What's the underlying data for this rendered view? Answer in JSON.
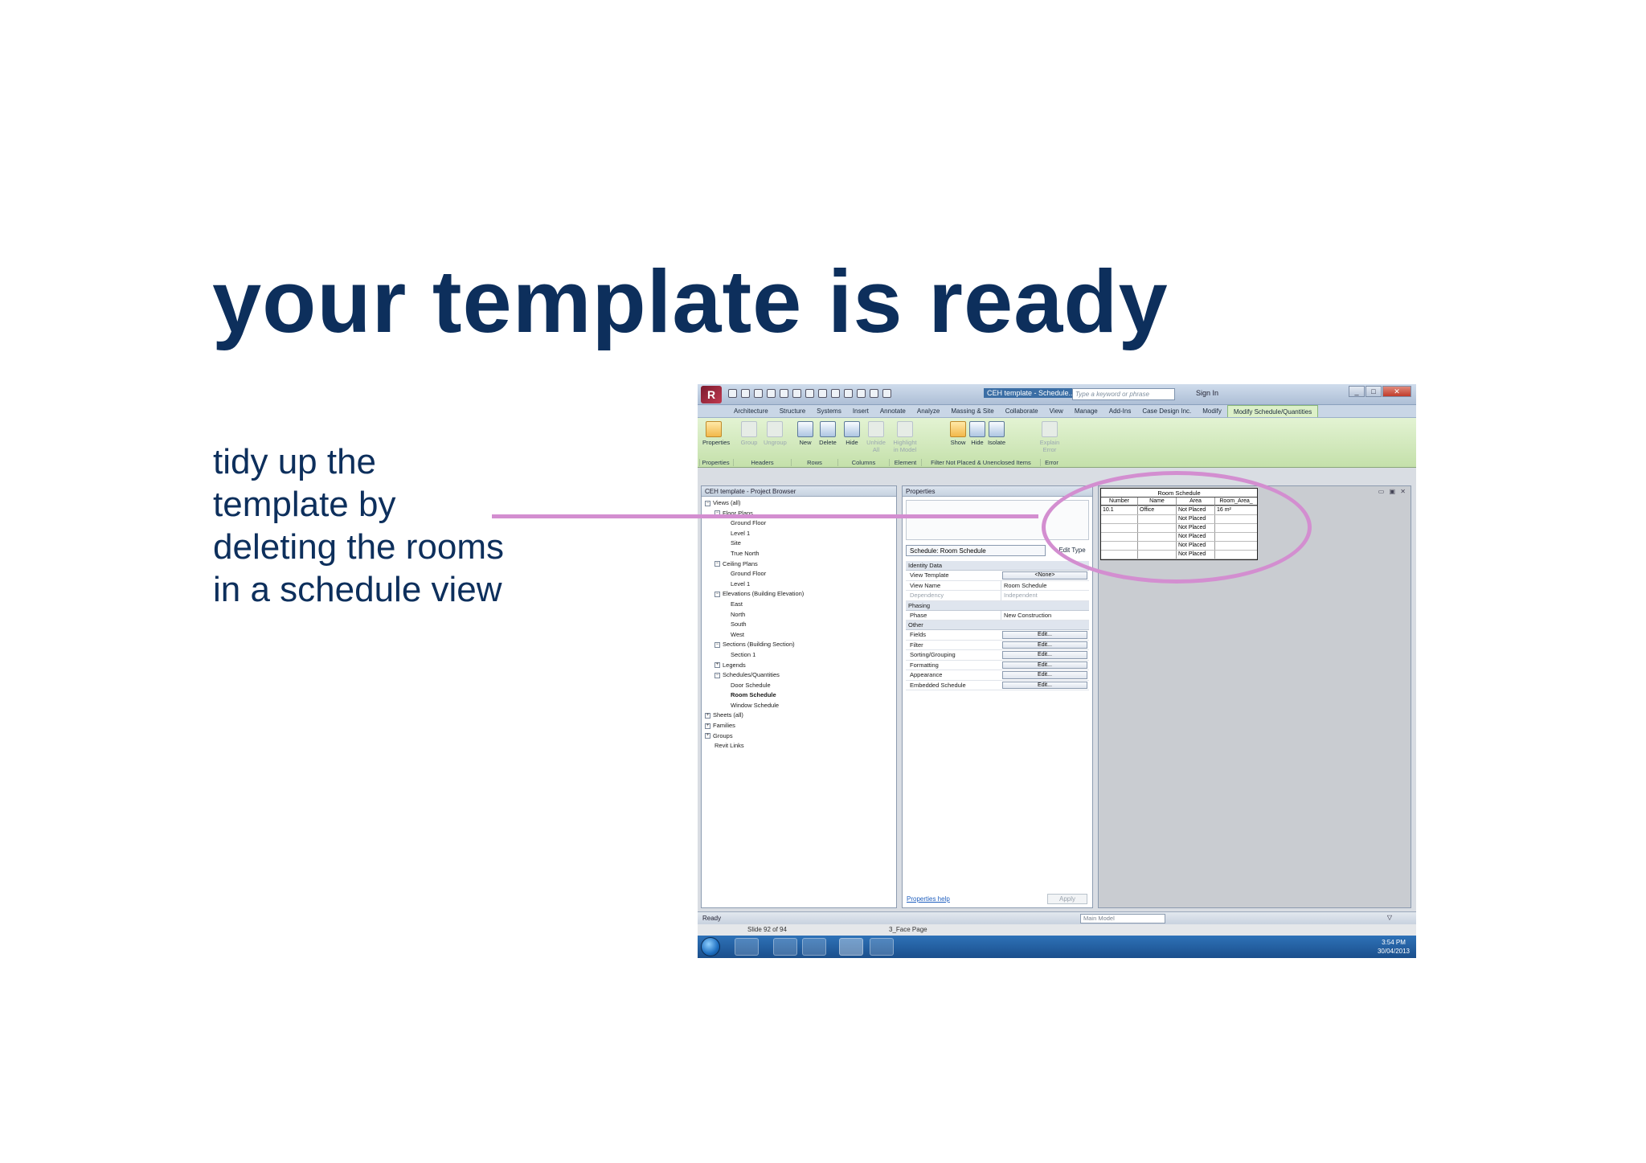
{
  "slide": {
    "title": "your template is ready",
    "body_lines": [
      "tidy up the",
      "template by",
      "deleting the rooms",
      "in a schedule view"
    ],
    "accent_color": "#d38ed0",
    "title_color": "#0d2f5c"
  },
  "app": {
    "window_title": "CEH template - Schedule...",
    "search_placeholder": "Type a keyword or phrase",
    "sign_in": "Sign In",
    "tabs": [
      "Architecture",
      "Structure",
      "Systems",
      "Insert",
      "Annotate",
      "Analyze",
      "Massing & Site",
      "Collaborate",
      "View",
      "Manage",
      "Add-Ins",
      "Case Design Inc.",
      "Modify",
      "Modify Schedule/Quantities"
    ],
    "ribbon": {
      "buttons": [
        "Properties",
        "Group",
        "Ungroup",
        "New",
        "Delete",
        "Hide",
        "Unhide All",
        "Highlight in Model",
        "Show",
        "Hide",
        "Isolate",
        "Explain Error"
      ],
      "panels": [
        "Properties",
        "Headers",
        "Rows",
        "Columns",
        "Element",
        "Filter Not Placed & Unenclosed Items",
        "Error"
      ]
    },
    "project_browser": {
      "title": "CEH template - Project Browser",
      "items": [
        "Views (all)",
        "Floor Plans",
        "Ground Floor",
        "Level 1",
        "Site",
        "True North",
        "Ceiling Plans",
        "Ground Floor",
        "Level 1",
        "Elevations (Building Elevation)",
        "East",
        "North",
        "South",
        "West",
        "Sections (Building Section)",
        "Section 1",
        "Legends",
        "Schedules/Quantities",
        "Door Schedule",
        "Room Schedule",
        "Window Schedule",
        "Sheets (all)",
        "Families",
        "Groups",
        "Revit Links"
      ]
    },
    "properties": {
      "title": "Properties",
      "type_selector": "Schedule: Room Schedule",
      "edit_type": "Edit Type",
      "groups": {
        "identity": "Identity Data",
        "phasing": "Phasing",
        "other": "Other"
      },
      "identity_rows": [
        {
          "k": "View Template",
          "v": "<None>"
        },
        {
          "k": "View Name",
          "v": "Room Schedule"
        },
        {
          "k": "Dependency",
          "v": "Independent"
        }
      ],
      "phase_rows": [
        {
          "k": "Phase",
          "v": "New Construction"
        }
      ],
      "other_rows": [
        {
          "k": "Fields",
          "v": "Edit..."
        },
        {
          "k": "Filter",
          "v": "Edit..."
        },
        {
          "k": "Sorting/Grouping",
          "v": "Edit..."
        },
        {
          "k": "Formatting",
          "v": "Edit..."
        },
        {
          "k": "Appearance",
          "v": "Edit..."
        },
        {
          "k": "Embedded Schedule",
          "v": "Edit..."
        }
      ],
      "help": "Properties help",
      "apply": "Apply"
    },
    "schedule": {
      "title": "Room Schedule",
      "headers": [
        "Number",
        "Name",
        "Area",
        "Room_Area_"
      ],
      "rows": [
        [
          "10.1",
          "Office",
          "Not Placed",
          "16 m²"
        ],
        [
          "",
          "",
          "Not Placed",
          ""
        ],
        [
          "",
          "",
          "Not Placed",
          ""
        ],
        [
          "",
          "",
          "Not Placed",
          ""
        ],
        [
          "",
          "",
          "Not Placed",
          ""
        ],
        [
          "",
          "",
          "Not Placed",
          ""
        ]
      ]
    },
    "status": {
      "ready": "Ready",
      "model": "Main Model"
    },
    "powerpoint": {
      "slide_number": "Slide 92 of 94",
      "face_page": "3_Face Page"
    },
    "taskbar": {
      "time": "3:54 PM",
      "date": "30/04/2013"
    }
  }
}
